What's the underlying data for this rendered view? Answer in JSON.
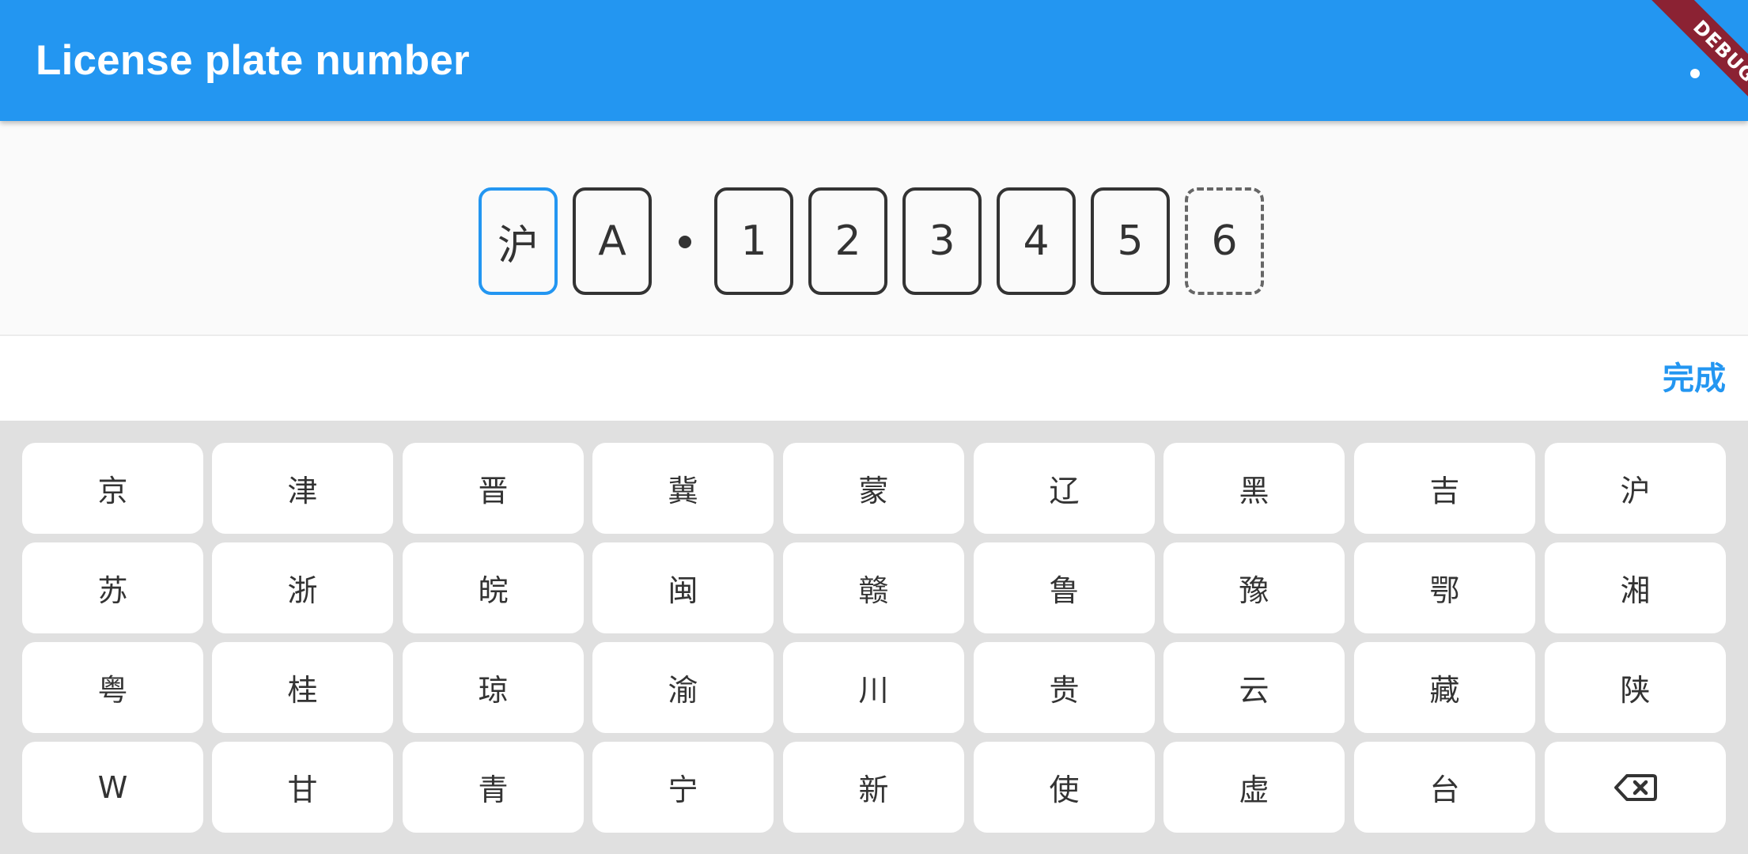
{
  "appbar": {
    "title": "License plate number",
    "debug_label": "DEBUG"
  },
  "plate": {
    "province": "沪",
    "letter": "A",
    "chars": [
      "1",
      "2",
      "3",
      "4",
      "5"
    ],
    "new_energy": "6"
  },
  "toolbar": {
    "done_label": "完成"
  },
  "keyboard": {
    "rows": [
      [
        "京",
        "津",
        "晋",
        "冀",
        "蒙",
        "辽",
        "黑",
        "吉",
        "沪"
      ],
      [
        "苏",
        "浙",
        "皖",
        "闽",
        "赣",
        "鲁",
        "豫",
        "鄂",
        "湘"
      ],
      [
        "粤",
        "桂",
        "琼",
        "渝",
        "川",
        "贵",
        "云",
        "藏",
        "陕"
      ],
      [
        "W",
        "甘",
        "青",
        "宁",
        "新",
        "使",
        "虚",
        "台"
      ]
    ],
    "backspace_icon": "backspace-icon"
  },
  "colors": {
    "primary": "#2396f1",
    "keyboard_bg": "#e0e0e0",
    "key_bg": "#ffffff",
    "text": "#333333",
    "debug": "#8b2233"
  }
}
